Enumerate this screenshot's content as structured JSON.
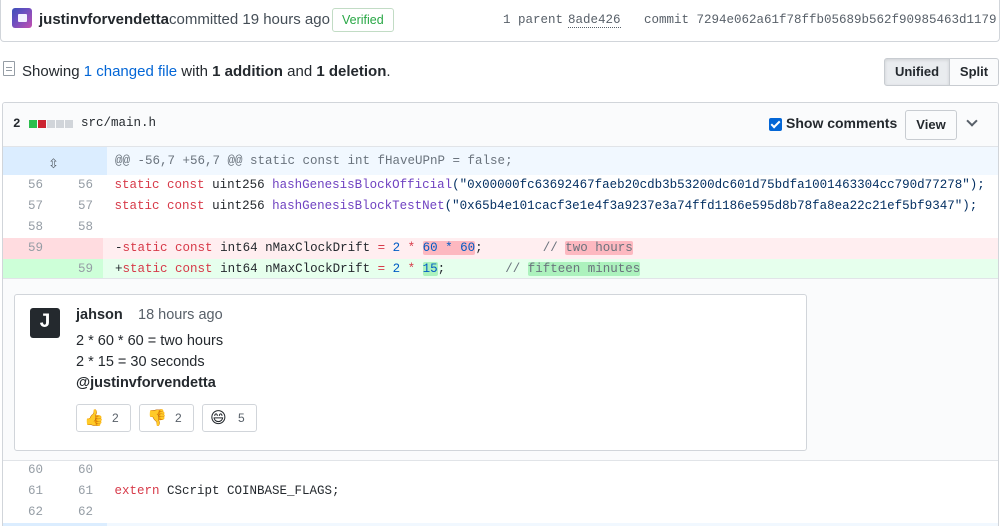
{
  "commit": {
    "author": "justinvforvendetta",
    "action": "committed 19 hours ago",
    "verified_label": "Verified",
    "parent_label": "1 parent",
    "parent_sha": "8ade426",
    "commit_label": "commit 7294e062a61f78ffb05689b562f90985463d1179"
  },
  "summary": {
    "prefix": "Showing ",
    "changed_link": "1 changed file",
    "with": " with ",
    "additions": "1 addition",
    "and": " and ",
    "deletions": "1 deletion",
    "suffix": "."
  },
  "view_toggle": {
    "unified": "Unified",
    "split": "Split"
  },
  "file": {
    "change_count": "2",
    "diffstat": [
      "add",
      "del",
      "neutral",
      "neutral",
      "neutral"
    ],
    "filename": "src/main.h",
    "show_comments_label": "Show comments",
    "view_label": "View"
  },
  "hunk_header": "@@ -56,7 +56,7 @@ static const int fHaveUPnP = false;",
  "lines": {
    "l56": {
      "old": "56",
      "new": "56"
    },
    "l57": {
      "old": "57",
      "new": "57"
    },
    "l58": {
      "old": "58",
      "new": "58"
    },
    "del": {
      "old": "59"
    },
    "add": {
      "new": "59"
    },
    "l60": {
      "old": "60",
      "new": "60"
    },
    "l61": {
      "old": "61",
      "new": "61"
    },
    "l62": {
      "old": "62",
      "new": "62"
    }
  },
  "code": {
    "kw_static": "static",
    "kw_const": "const",
    "kw_extern": "extern",
    "uint256": " uint256 ",
    "int64": " int64 ",
    "fn_official": "hashGenesisBlockOfficial",
    "str_official": "(\"0x00000fc63692467faeb20cdb3b53200dc601d75bdfa1001463304cc790d77278\");",
    "fn_testnet": "hashGenesisBlockTestNet",
    "str_testnet": "(\"0x65b4e101cacf3e1e4f3a9237e3a74ffd1186e595d8b78fa8ea22c21ef5bf9347\");",
    "del_minus": "-",
    "add_plus": "+",
    "drift_name": "nMaxClockDrift",
    "eq": " = ",
    "two": "2",
    "mul": " * ",
    "sixty_mul_sixty": "60 * 60",
    "fifteen": "15",
    "semi_del": ";        ",
    "semi_add": ";        ",
    "comment_slashes": "// ",
    "two_hours": "two hours",
    "fifteen_minutes": "fifteen minutes",
    "cscript_line": " CScript COINBASE_FLAGS;"
  },
  "comment": {
    "avatar_letter": "J",
    "author": "jahson",
    "time": "18 hours ago",
    "line1": "2 * 60 * 60 = two hours",
    "line2": "2 * 15 = 30 seconds",
    "mention": "@justinvforvendetta",
    "reactions": [
      {
        "icon": "thumbs-up-icon",
        "glyph": "👍",
        "count": "2"
      },
      {
        "icon": "thumbs-down-icon",
        "glyph": "👎",
        "count": "2"
      },
      {
        "icon": "smile-icon",
        "glyph": "😄",
        "count": "5"
      }
    ]
  },
  "colors": {
    "link": "#0366d6",
    "verified": "#28a745",
    "deletion_bg": "#ffeef0",
    "addition_bg": "#e6ffed",
    "hunk_bg": "#f1f8ff"
  }
}
